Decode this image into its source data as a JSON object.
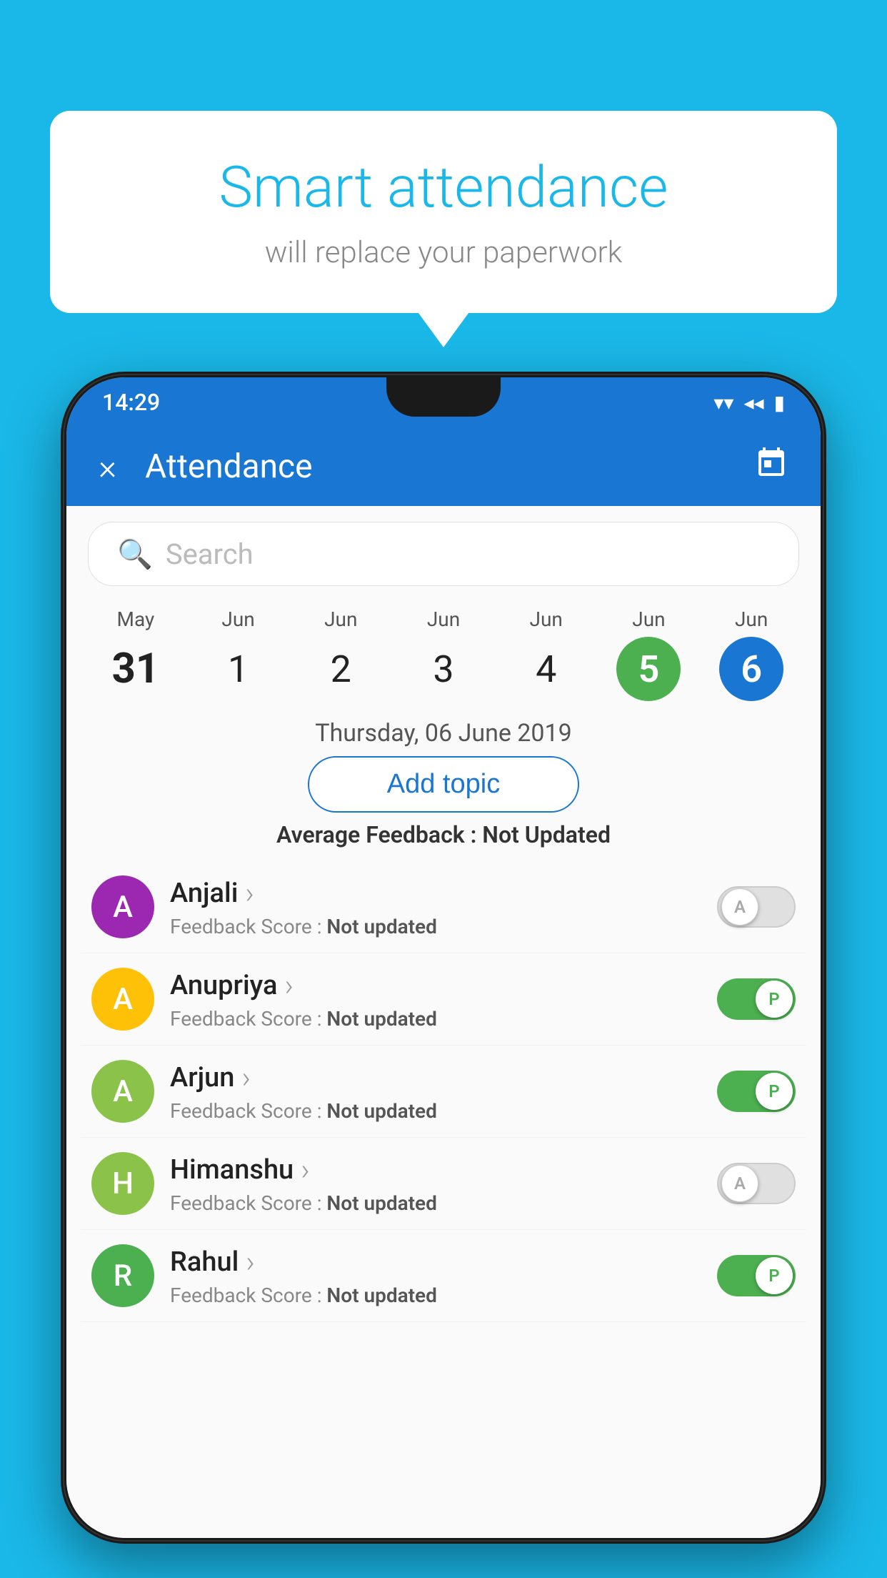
{
  "background_color": "#1ab8e8",
  "bubble": {
    "title": "Smart attendance",
    "subtitle": "will replace your paperwork"
  },
  "status_bar": {
    "time": "14:29",
    "wifi_icon": "▼",
    "signal_icon": "◂",
    "battery_icon": "▮"
  },
  "header": {
    "title": "Attendance",
    "close_label": "×",
    "calendar_icon": "📅"
  },
  "search": {
    "placeholder": "Search"
  },
  "calendar": {
    "days": [
      {
        "month": "May",
        "date": "31",
        "style": "bold"
      },
      {
        "month": "Jun",
        "date": "1",
        "style": "normal"
      },
      {
        "month": "Jun",
        "date": "2",
        "style": "normal"
      },
      {
        "month": "Jun",
        "date": "3",
        "style": "normal"
      },
      {
        "month": "Jun",
        "date": "4",
        "style": "normal"
      },
      {
        "month": "Jun",
        "date": "5",
        "style": "today"
      },
      {
        "month": "Jun",
        "date": "6",
        "style": "selected"
      }
    ]
  },
  "date_label": "Thursday, 06 June 2019",
  "add_topic_label": "Add topic",
  "avg_feedback_label": "Average Feedback :",
  "avg_feedback_value": "Not Updated",
  "students": [
    {
      "name": "Anjali",
      "avatar_letter": "A",
      "avatar_color": "#9c27b0",
      "feedback_label": "Feedback Score :",
      "feedback_value": "Not updated",
      "toggle": "off"
    },
    {
      "name": "Anupriya",
      "avatar_letter": "A",
      "avatar_color": "#ffc107",
      "feedback_label": "Feedback Score :",
      "feedback_value": "Not updated",
      "toggle": "on"
    },
    {
      "name": "Arjun",
      "avatar_letter": "A",
      "avatar_color": "#8bc34a",
      "feedback_label": "Feedback Score :",
      "feedback_value": "Not updated",
      "toggle": "on"
    },
    {
      "name": "Himanshu",
      "avatar_letter": "H",
      "avatar_color": "#8bc34a",
      "feedback_label": "Feedback Score :",
      "feedback_value": "Not updated",
      "toggle": "off"
    },
    {
      "name": "Rahul",
      "avatar_letter": "R",
      "avatar_color": "#4caf50",
      "feedback_label": "Feedback Score :",
      "feedback_value": "Not updated",
      "toggle": "on"
    }
  ],
  "toggle_on_label": "P",
  "toggle_off_label": "A"
}
